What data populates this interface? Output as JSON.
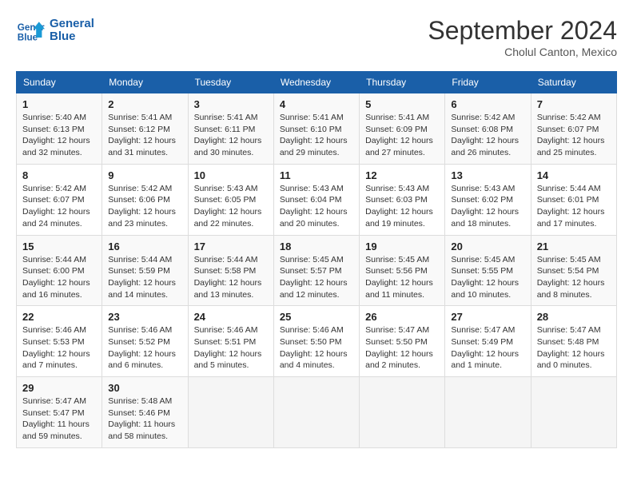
{
  "logo": {
    "line1": "General",
    "line2": "Blue"
  },
  "title": "September 2024",
  "subtitle": "Cholul Canton, Mexico",
  "weekdays": [
    "Sunday",
    "Monday",
    "Tuesday",
    "Wednesday",
    "Thursday",
    "Friday",
    "Saturday"
  ],
  "weeks": [
    [
      {
        "day": "1",
        "info": "Sunrise: 5:40 AM\nSunset: 6:13 PM\nDaylight: 12 hours\nand 32 minutes."
      },
      {
        "day": "2",
        "info": "Sunrise: 5:41 AM\nSunset: 6:12 PM\nDaylight: 12 hours\nand 31 minutes."
      },
      {
        "day": "3",
        "info": "Sunrise: 5:41 AM\nSunset: 6:11 PM\nDaylight: 12 hours\nand 30 minutes."
      },
      {
        "day": "4",
        "info": "Sunrise: 5:41 AM\nSunset: 6:10 PM\nDaylight: 12 hours\nand 29 minutes."
      },
      {
        "day": "5",
        "info": "Sunrise: 5:41 AM\nSunset: 6:09 PM\nDaylight: 12 hours\nand 27 minutes."
      },
      {
        "day": "6",
        "info": "Sunrise: 5:42 AM\nSunset: 6:08 PM\nDaylight: 12 hours\nand 26 minutes."
      },
      {
        "day": "7",
        "info": "Sunrise: 5:42 AM\nSunset: 6:07 PM\nDaylight: 12 hours\nand 25 minutes."
      }
    ],
    [
      {
        "day": "8",
        "info": "Sunrise: 5:42 AM\nSunset: 6:07 PM\nDaylight: 12 hours\nand 24 minutes."
      },
      {
        "day": "9",
        "info": "Sunrise: 5:42 AM\nSunset: 6:06 PM\nDaylight: 12 hours\nand 23 minutes."
      },
      {
        "day": "10",
        "info": "Sunrise: 5:43 AM\nSunset: 6:05 PM\nDaylight: 12 hours\nand 22 minutes."
      },
      {
        "day": "11",
        "info": "Sunrise: 5:43 AM\nSunset: 6:04 PM\nDaylight: 12 hours\nand 20 minutes."
      },
      {
        "day": "12",
        "info": "Sunrise: 5:43 AM\nSunset: 6:03 PM\nDaylight: 12 hours\nand 19 minutes."
      },
      {
        "day": "13",
        "info": "Sunrise: 5:43 AM\nSunset: 6:02 PM\nDaylight: 12 hours\nand 18 minutes."
      },
      {
        "day": "14",
        "info": "Sunrise: 5:44 AM\nSunset: 6:01 PM\nDaylight: 12 hours\nand 17 minutes."
      }
    ],
    [
      {
        "day": "15",
        "info": "Sunrise: 5:44 AM\nSunset: 6:00 PM\nDaylight: 12 hours\nand 16 minutes."
      },
      {
        "day": "16",
        "info": "Sunrise: 5:44 AM\nSunset: 5:59 PM\nDaylight: 12 hours\nand 14 minutes."
      },
      {
        "day": "17",
        "info": "Sunrise: 5:44 AM\nSunset: 5:58 PM\nDaylight: 12 hours\nand 13 minutes."
      },
      {
        "day": "18",
        "info": "Sunrise: 5:45 AM\nSunset: 5:57 PM\nDaylight: 12 hours\nand 12 minutes."
      },
      {
        "day": "19",
        "info": "Sunrise: 5:45 AM\nSunset: 5:56 PM\nDaylight: 12 hours\nand 11 minutes."
      },
      {
        "day": "20",
        "info": "Sunrise: 5:45 AM\nSunset: 5:55 PM\nDaylight: 12 hours\nand 10 minutes."
      },
      {
        "day": "21",
        "info": "Sunrise: 5:45 AM\nSunset: 5:54 PM\nDaylight: 12 hours\nand 8 minutes."
      }
    ],
    [
      {
        "day": "22",
        "info": "Sunrise: 5:46 AM\nSunset: 5:53 PM\nDaylight: 12 hours\nand 7 minutes."
      },
      {
        "day": "23",
        "info": "Sunrise: 5:46 AM\nSunset: 5:52 PM\nDaylight: 12 hours\nand 6 minutes."
      },
      {
        "day": "24",
        "info": "Sunrise: 5:46 AM\nSunset: 5:51 PM\nDaylight: 12 hours\nand 5 minutes."
      },
      {
        "day": "25",
        "info": "Sunrise: 5:46 AM\nSunset: 5:50 PM\nDaylight: 12 hours\nand 4 minutes."
      },
      {
        "day": "26",
        "info": "Sunrise: 5:47 AM\nSunset: 5:50 PM\nDaylight: 12 hours\nand 2 minutes."
      },
      {
        "day": "27",
        "info": "Sunrise: 5:47 AM\nSunset: 5:49 PM\nDaylight: 12 hours\nand 1 minute."
      },
      {
        "day": "28",
        "info": "Sunrise: 5:47 AM\nSunset: 5:48 PM\nDaylight: 12 hours\nand 0 minutes."
      }
    ],
    [
      {
        "day": "29",
        "info": "Sunrise: 5:47 AM\nSunset: 5:47 PM\nDaylight: 11 hours\nand 59 minutes."
      },
      {
        "day": "30",
        "info": "Sunrise: 5:48 AM\nSunset: 5:46 PM\nDaylight: 11 hours\nand 58 minutes."
      },
      null,
      null,
      null,
      null,
      null
    ]
  ]
}
